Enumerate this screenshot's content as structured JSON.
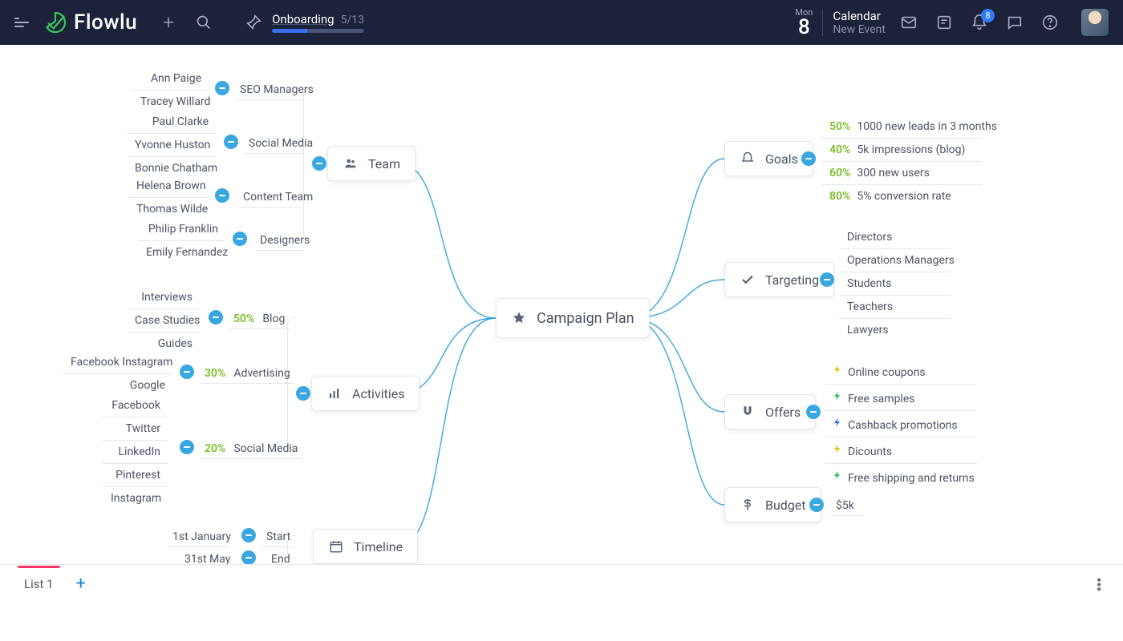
{
  "app": {
    "name": "Flowlu"
  },
  "top": {
    "onboarding": {
      "label": "Onboarding",
      "count": "5/13"
    },
    "date": {
      "dow": "Mon",
      "day": "8"
    },
    "calendar": {
      "title": "Calendar",
      "sub": "New Event"
    },
    "notif_count": "8"
  },
  "center": {
    "label": "Campaign Plan"
  },
  "team": {
    "label": "Team",
    "groups": [
      {
        "label": "SEO Managers",
        "members": [
          "Ann Paige",
          "Tracey  Willard"
        ]
      },
      {
        "label": "Social Media",
        "members": [
          "Paul Clarke",
          "Yvonne Huston",
          "Bonnie Chatham"
        ]
      },
      {
        "label": "Content Team",
        "members": [
          "Helena Brown",
          "Thomas Wilde"
        ]
      },
      {
        "label": "Designers",
        "members": [
          "Philip Franklin",
          "Emily Fernandez"
        ]
      }
    ]
  },
  "activities": {
    "label": "Activities",
    "groups": [
      {
        "label": "Blog",
        "pct": "50%",
        "items": [
          "Interviews",
          "Case Studies",
          "Guides"
        ]
      },
      {
        "label": "Advertising",
        "pct": "30%",
        "items": [
          "Facebook   Instagram",
          "Google"
        ]
      },
      {
        "label": "Social Media",
        "pct": "20%",
        "items": [
          "Facebook",
          "Twitter",
          "LinkedIn",
          "Pinterest",
          "Instagram"
        ]
      }
    ]
  },
  "timeline": {
    "label": "Timeline",
    "rows": [
      {
        "label": "Start",
        "value": "1st January"
      },
      {
        "label": "End",
        "value": "31st May"
      }
    ]
  },
  "goals": {
    "label": "Goals",
    "rows": [
      {
        "pct": "50%",
        "text": "1000 new leads in 3 months"
      },
      {
        "pct": "40%",
        "text": "5k impressions (blog)"
      },
      {
        "pct": "60%",
        "text": "300 new users"
      },
      {
        "pct": "80%",
        "text": "5% conversion rate"
      }
    ]
  },
  "targeting": {
    "label": "Targeting",
    "rows": [
      "Directors",
      "Operations Managers",
      "Students",
      "Teachers",
      "Lawyers"
    ]
  },
  "offers": {
    "label": "Offers",
    "rows": [
      {
        "color": "y",
        "text": "Online coupons"
      },
      {
        "color": "g",
        "text": "Free samples"
      },
      {
        "color": "b",
        "text": "Cashback promotions"
      },
      {
        "color": "y",
        "text": "Dicounts"
      },
      {
        "color": "g",
        "text": "Free shipping and returns"
      }
    ]
  },
  "budget": {
    "label": "Budget",
    "value": "$5k"
  },
  "bottom": {
    "tab": "List 1"
  }
}
